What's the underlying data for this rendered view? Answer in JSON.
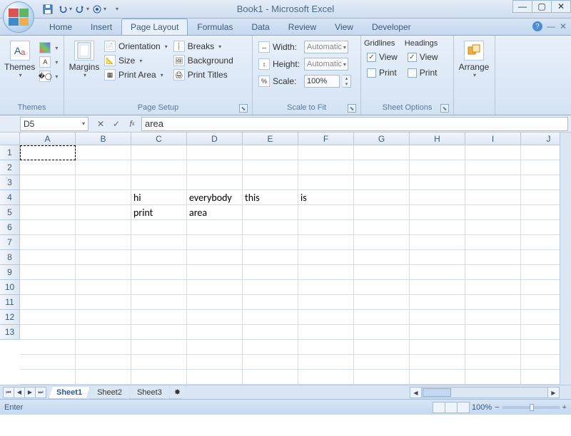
{
  "title": "Book1 - Microsoft Excel",
  "qat": {
    "save": "save-icon",
    "undo": "undo-icon",
    "redo": "redo-icon",
    "preview": "print-preview-icon"
  },
  "tabs": [
    "Home",
    "Insert",
    "Page Layout",
    "Formulas",
    "Data",
    "Review",
    "View",
    "Developer"
  ],
  "active_tab": 2,
  "ribbon": {
    "themes": {
      "label": "Themes",
      "themes_btn": "Themes",
      "colors": "colors-icon",
      "fonts": "fonts-icon",
      "effects": "effects-icon"
    },
    "page_setup": {
      "label": "Page Setup",
      "margins": "Margins",
      "orientation": "Orientation",
      "size": "Size",
      "print_area": "Print Area",
      "breaks": "Breaks",
      "background": "Background",
      "print_titles": "Print Titles"
    },
    "scale": {
      "label": "Scale to Fit",
      "width": "Width:",
      "width_val": "Automatic",
      "height": "Height:",
      "height_val": "Automatic",
      "scale": "Scale:",
      "scale_val": "100%"
    },
    "sheet_options": {
      "label": "Sheet Options",
      "gridlines": "Gridlines",
      "headings": "Headings",
      "view": "View",
      "print": "Print",
      "grid_view_checked": true,
      "grid_print_checked": false,
      "head_view_checked": true,
      "head_print_checked": false
    },
    "arrange": {
      "label": "Arrange",
      "btn": "Arrange"
    }
  },
  "namebox": "D5",
  "formula": "area",
  "columns": [
    "A",
    "B",
    "C",
    "D",
    "E",
    "F",
    "G",
    "H",
    "I",
    "J"
  ],
  "rows": [
    1,
    2,
    3,
    4,
    5,
    6,
    7,
    8,
    9,
    10,
    11,
    12,
    13
  ],
  "cells": {
    "r4": {
      "C": "hi",
      "D": "everybody",
      "E": "this",
      "F": "is"
    },
    "r5": {
      "C": "print",
      "D": "area"
    }
  },
  "selection": "A1",
  "sheets": [
    "Sheet1",
    "Sheet2",
    "Sheet3"
  ],
  "active_sheet": 0,
  "status": "Enter",
  "zoom": "100%"
}
